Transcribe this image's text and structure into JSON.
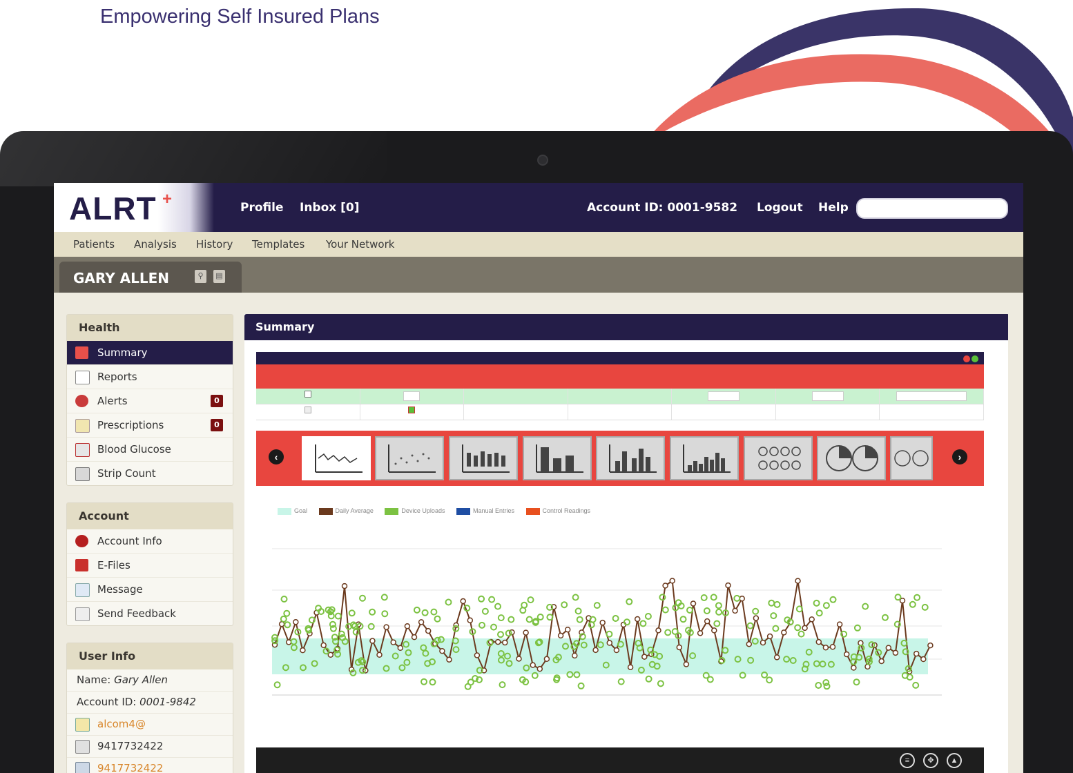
{
  "tagline": "Empowering Self Insured Plans",
  "header": {
    "logo": "ALRT",
    "logo_mark": "+",
    "nav": [
      "Profile",
      "Inbox [0]"
    ],
    "account_id": "Account ID: 0001-9582",
    "logout": "Logout",
    "help": "Help",
    "search_value": ""
  },
  "menu": [
    "Patients",
    "Analysis",
    "History",
    "Templates",
    "Your Network"
  ],
  "patient": {
    "name": "GARY ALLEN"
  },
  "sidebar": {
    "health": {
      "title": "Health",
      "items": [
        {
          "label": "Summary",
          "icon": "summary-icon"
        },
        {
          "label": "Reports",
          "icon": "reports-icon"
        },
        {
          "label": "Alerts",
          "icon": "alerts-icon",
          "badge": "0"
        },
        {
          "label": "Prescriptions",
          "icon": "prescriptions-icon",
          "badge": "0"
        },
        {
          "label": "Blood Glucose",
          "icon": "blood-glucose-icon"
        },
        {
          "label": "Strip Count",
          "icon": "strip-count-icon"
        }
      ]
    },
    "account": {
      "title": "Account",
      "items": [
        {
          "label": "Account Info",
          "icon": "info-icon"
        },
        {
          "label": "E-Files",
          "icon": "folder-icon"
        },
        {
          "label": "Message",
          "icon": "message-icon"
        },
        {
          "label": "Send Feedback",
          "icon": "feedback-icon"
        }
      ]
    },
    "user": {
      "title": "User Info",
      "name_label": "Name: ",
      "name_value": "Gary Allen",
      "account_label": "Account ID: ",
      "account_value": "0001-9842",
      "email": "alcom4@",
      "phone": "9417732422",
      "mobile": "9417732422"
    }
  },
  "main": {
    "title": "Summary",
    "legend": [
      "Goal",
      "Daily Average",
      "Device Uploads",
      "Manual Entries",
      "Control Readings"
    ],
    "legend_colors": [
      "#c8f5e8",
      "#6b3a1e",
      "#7cc242",
      "#1f4ea3",
      "#e8501f"
    ],
    "accent": "#241d48",
    "alert_red": "#e8463f"
  }
}
